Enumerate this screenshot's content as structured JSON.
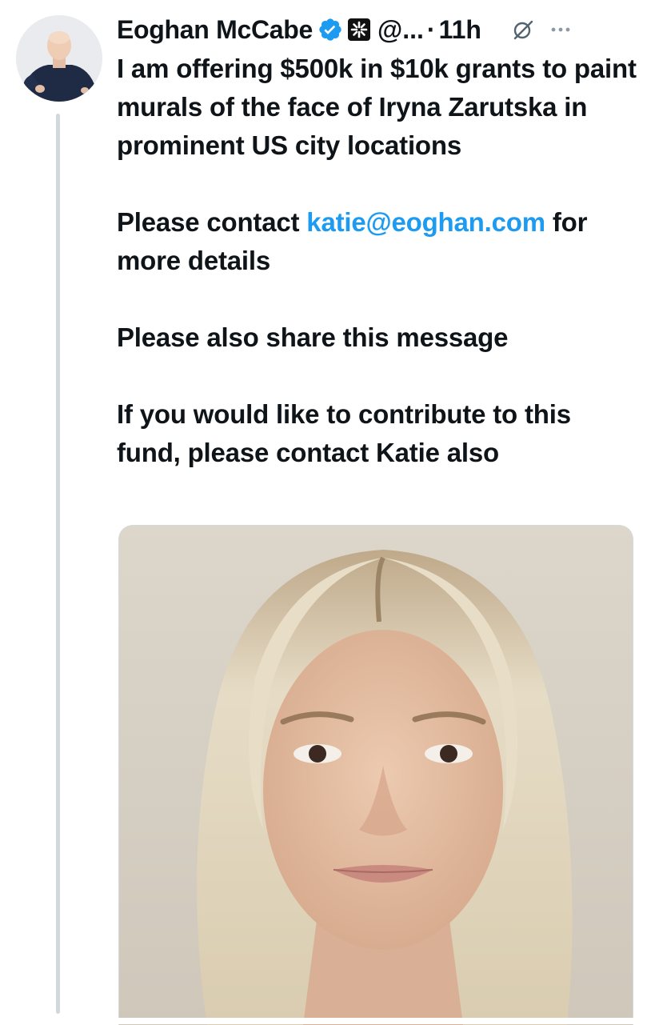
{
  "tweet": {
    "author": {
      "display_name": "Eoghan McCabe",
      "handle": "@...",
      "avatar_icon": "profile-photo-bald-man-navy-sweater"
    },
    "badges": {
      "verified_icon": "verified-checkmark-icon",
      "verified_color": "#1d9bf0",
      "affiliate_icon": "company-affiliate-logo-icon"
    },
    "separator": "·",
    "timestamp": "11h",
    "actions": {
      "grok_icon": "grok-slash-icon",
      "more_icon": "more-dots-icon"
    },
    "paragraphs": {
      "p1": "I am offering $500k in $10k grants to paint murals of the face of Iryna Zarutska in prominent US city locations",
      "p2_before": "Please contact ",
      "p2_link": "katie@eoghan.com",
      "p2_after": " for more details",
      "p3": "Please also share this message",
      "p4": "If you would like to contribute to this fund, please contact Katie also"
    },
    "media": {
      "description_icon": "portrait-photo-blonde-woman"
    }
  },
  "colors": {
    "text": "#0f1419",
    "link": "#1d9bf0",
    "thread_line": "#cfd9de",
    "background": "#ffffff"
  }
}
